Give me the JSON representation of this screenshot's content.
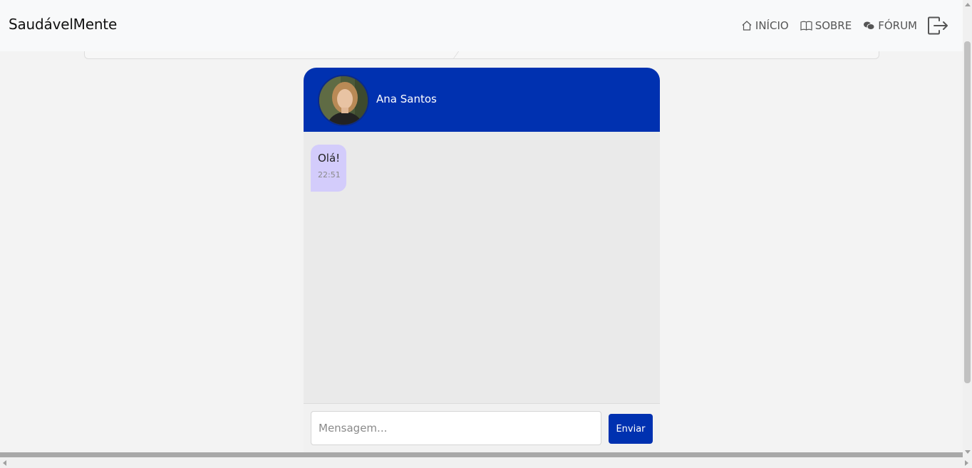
{
  "navbar": {
    "brand": "SaudávelMente",
    "links": [
      {
        "label": "INÍCIO",
        "icon": "house-icon"
      },
      {
        "label": "SOBRE",
        "icon": "book-icon"
      },
      {
        "label": "FÓRUM",
        "icon": "chat-bubbles-icon"
      }
    ],
    "logout_icon": "logout-icon"
  },
  "chat": {
    "contact": {
      "name": "Ana Santos",
      "avatar": "profile-photo"
    },
    "messages": [
      {
        "text": "Olá!",
        "time": "22:51"
      }
    ],
    "composer": {
      "placeholder": "Mensagem...",
      "value": "",
      "send_label": "Enviar"
    }
  },
  "colors": {
    "accent": "#0031b0",
    "bubble": "#d3ccfb",
    "chat_background": "#eaeaea",
    "page_background": "#f3f3f3"
  }
}
